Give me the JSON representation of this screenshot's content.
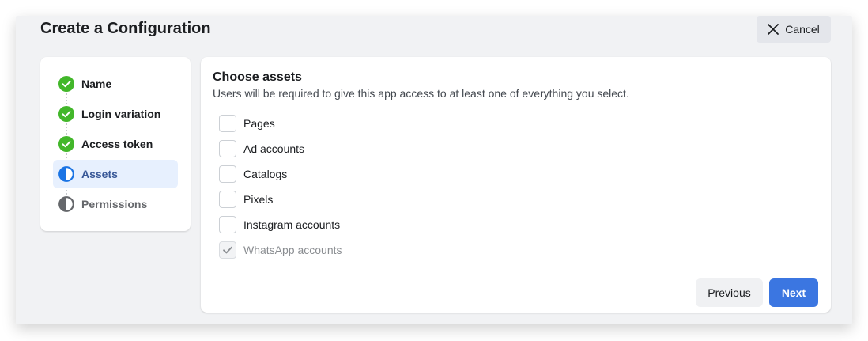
{
  "dialog": {
    "title": "Create a Configuration",
    "cancel_label": "Cancel"
  },
  "steps": [
    {
      "label": "Name",
      "status": "complete"
    },
    {
      "label": "Login variation",
      "status": "complete"
    },
    {
      "label": "Access token",
      "status": "complete"
    },
    {
      "label": "Assets",
      "status": "current"
    },
    {
      "label": "Permissions",
      "status": "pending"
    }
  ],
  "assets_section": {
    "title": "Choose assets",
    "description": "Users will be required to give this app access to at least one of everything you select.",
    "items": [
      {
        "label": "Pages",
        "checked": false,
        "disabled": false
      },
      {
        "label": "Ad accounts",
        "checked": false,
        "disabled": false
      },
      {
        "label": "Catalogs",
        "checked": false,
        "disabled": false
      },
      {
        "label": "Pixels",
        "checked": false,
        "disabled": false
      },
      {
        "label": "Instagram accounts",
        "checked": false,
        "disabled": false
      },
      {
        "label": "WhatsApp accounts",
        "checked": true,
        "disabled": true
      }
    ]
  },
  "footer": {
    "previous_label": "Previous",
    "next_label": "Next"
  },
  "colors": {
    "complete_green": "#42b72a",
    "current_blue": "#1b74e4",
    "primary_button": "#3b76e1"
  }
}
